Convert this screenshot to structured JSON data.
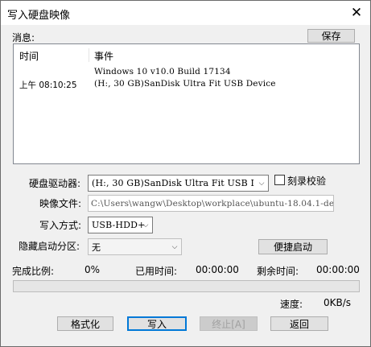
{
  "window": {
    "title": "写入硬盘映像",
    "close_glyph": "✕"
  },
  "messages": {
    "label": "消息:",
    "save_label": "保存",
    "col_time": "时间",
    "col_event": "事件",
    "rows": [
      {
        "time": "",
        "event": "Windows 10 v10.0 Build 17134"
      },
      {
        "time": "上午 08:10:25",
        "event": "(H:, 30 GB)SanDisk Ultra Fit USB Device"
      }
    ]
  },
  "form": {
    "drive_label": "硬盘驱动器:",
    "drive_value": "(H:, 30 GB)SanDisk Ultra Fit USB I",
    "verify_label": "刻录校验",
    "verify_checked": false,
    "image_label": "映像文件:",
    "image_value": "C:\\Users\\wangw\\Desktop\\workplace\\ubuntu-18.04.1-de",
    "method_label": "写入方式:",
    "method_value": "USB-HDD+",
    "hidden_label": "隐藏启动分区:",
    "hidden_value": "无",
    "quick_boot_label": "便捷启动"
  },
  "status": {
    "complete_label": "完成比例:",
    "complete_value": "0%",
    "elapsed_label": "已用时间:",
    "elapsed_value": "00:00:00",
    "remaining_label": "剩余时间:",
    "remaining_value": "00:00:00",
    "progress_fraction": 0,
    "speed_label": "速度:",
    "speed_value": "0KB/s"
  },
  "buttons": {
    "format": "格式化",
    "write": "写入",
    "stop": "终止[A]",
    "back": "返回"
  },
  "colors": {
    "progress": "#06b025",
    "accent": "#0078d7"
  }
}
